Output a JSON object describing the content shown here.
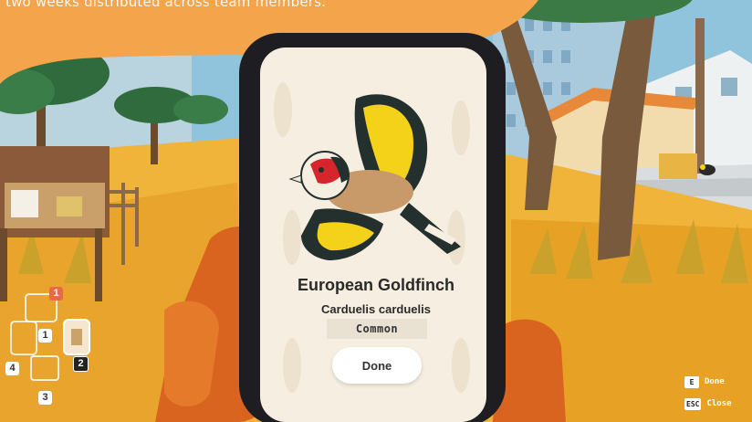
{
  "overlay": {
    "text": "two weeks distributed across team members."
  },
  "field_guide": {
    "common_name": "European Goldfinch",
    "scientific_name": "Carduelis carduelis",
    "rarity": "Common",
    "done_label": "Done"
  },
  "hud": {
    "hints": [
      {
        "key": "E",
        "label": "Done"
      },
      {
        "key": "ESC",
        "label": "Close"
      }
    ],
    "inventory": {
      "badge": "1",
      "slots": [
        "1",
        "2",
        "3",
        "4"
      ]
    }
  },
  "colors": {
    "sky": "#f3b24b",
    "ground": "#f0b43a",
    "phone_body": "#1e1e22",
    "screen_bg": "#f6efe1",
    "goldfinch_yellow": "#f5d21a",
    "goldfinch_red": "#d6262b",
    "hand_orange": "#d8641f"
  }
}
